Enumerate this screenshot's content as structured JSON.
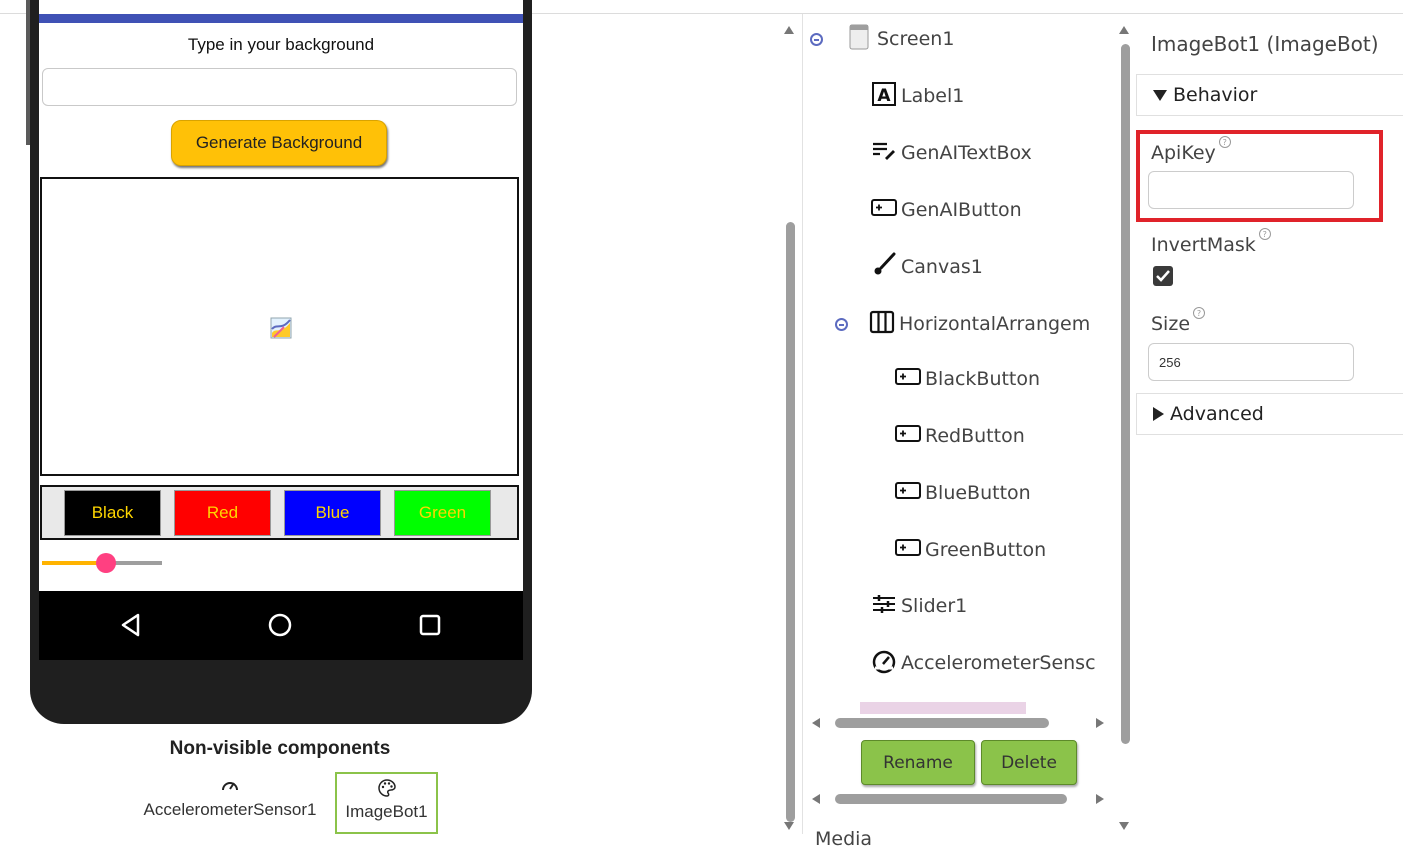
{
  "viewer": {
    "label_text": "Type in your background",
    "textbox_value": "",
    "generate_button": "Generate Background",
    "color_buttons": [
      {
        "label": "Black",
        "bg": "#000000"
      },
      {
        "label": "Red",
        "bg": "#ff0000"
      },
      {
        "label": "Blue",
        "bg": "#0000ff"
      },
      {
        "label": "Green",
        "bg": "#00ff00"
      }
    ],
    "slider_value_fraction": 0.53,
    "accent_colors": {
      "statusbar": "#3f51b5",
      "generate_button": "#ffc107",
      "slider_thumb": "#ff4081",
      "slider_track": "#ffb300"
    }
  },
  "nonvisible": {
    "title": "Non-visible components",
    "items": [
      {
        "label": "AccelerometerSensor1",
        "icon": "speedometer-icon"
      },
      {
        "label": "ImageBot1",
        "icon": "palette-icon",
        "selected": true
      }
    ]
  },
  "tree": {
    "items": [
      {
        "label": "Screen1",
        "icon": "screen-icon"
      },
      {
        "label": "Label1",
        "icon": "label-icon"
      },
      {
        "label": "GenAITextBox",
        "icon": "textbox-icon"
      },
      {
        "label": "GenAIButton",
        "icon": "button-icon"
      },
      {
        "label": "Canvas1",
        "icon": "brush-icon"
      },
      {
        "label": "HorizontalArrangem",
        "icon": "columns-icon"
      },
      {
        "label": "BlackButton",
        "icon": "button-icon"
      },
      {
        "label": "RedButton",
        "icon": "button-icon"
      },
      {
        "label": "BlueButton",
        "icon": "button-icon"
      },
      {
        "label": "GreenButton",
        "icon": "button-icon"
      },
      {
        "label": "Slider1",
        "icon": "slider-icon"
      },
      {
        "label": "AccelerometerSensc",
        "icon": "speedometer-icon"
      }
    ],
    "rename_button": "Rename",
    "delete_button": "Delete",
    "next_section_cut": "Media"
  },
  "properties": {
    "header": "ImageBot1 (ImageBot)",
    "behavior_section": "Behavior",
    "apikey_label": "ApiKey",
    "apikey_value": "",
    "invertmask_label": "InvertMask",
    "invertmask_checked": true,
    "size_label": "Size",
    "size_value": "256",
    "advanced_section": "Advanced",
    "help_glyph": "?",
    "highlight_color": "#e0232a"
  }
}
